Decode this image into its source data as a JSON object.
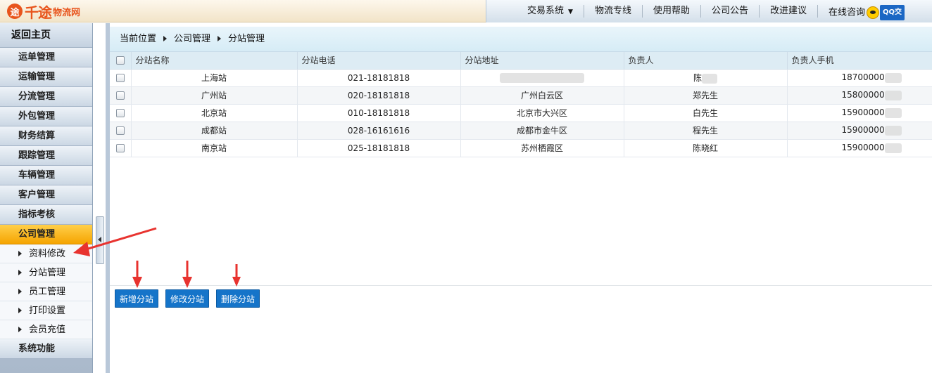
{
  "brand": {
    "mark": "途",
    "name_big": "千途",
    "name_small": "物流网"
  },
  "nav": {
    "items": [
      "交易系统",
      "物流专线",
      "使用帮助",
      "公司公告",
      "改进建议",
      "在线咨询"
    ],
    "qq_label": "QQ交"
  },
  "sidebar": {
    "home": "返回主页",
    "items": [
      "运单管理",
      "运输管理",
      "分流管理",
      "外包管理",
      "财务结算",
      "跟踪管理",
      "车辆管理",
      "客户管理",
      "指标考核",
      "公司管理"
    ],
    "sub_items": [
      "资料修改",
      "分站管理",
      "员工管理",
      "打印设置",
      "会员充值"
    ],
    "footer_item": "系统功能"
  },
  "breadcrumb": [
    "当前位置",
    "公司管理",
    "分站管理"
  ],
  "table": {
    "headers": [
      "分站名称",
      "分站电话",
      "分站地址",
      "负责人",
      "负责人手机"
    ],
    "rows": [
      {
        "name": "上海站",
        "phone": "021-18181818",
        "address": "",
        "manager": "陈",
        "mobile": "18700000"
      },
      {
        "name": "广州站",
        "phone": "020-18181818",
        "address": "广州白云区",
        "manager": "郑先生",
        "mobile": "15800000"
      },
      {
        "name": "北京站",
        "phone": "010-18181818",
        "address": "北京市大兴区",
        "manager": "白先生",
        "mobile": "15900000"
      },
      {
        "name": "成都站",
        "phone": "028-16161616",
        "address": "成都市金牛区",
        "manager": "程先生",
        "mobile": "15900000"
      },
      {
        "name": "南京站",
        "phone": "025-18181818",
        "address": "苏州栖霞区",
        "manager": "陈晓红",
        "mobile": "15900000"
      }
    ]
  },
  "toolbar": {
    "add": "新增分站",
    "edit": "修改分站",
    "delete": "删除分站"
  },
  "colors": {
    "accent_blue": "#1574c9",
    "active_orange": "#f5a400",
    "annotation_red": "#e8332f"
  }
}
